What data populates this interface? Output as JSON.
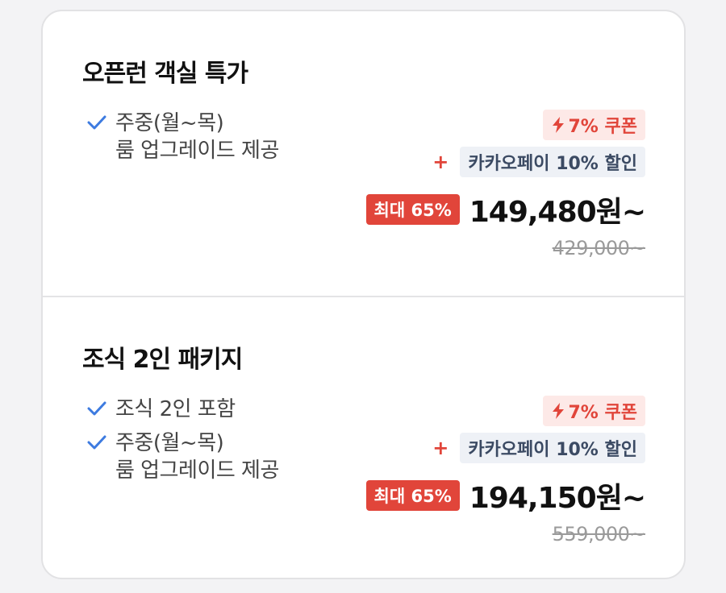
{
  "offers": [
    {
      "title": "오픈런 객실 특가",
      "benefits": [
        "주중(월~목)\n룸 업그레이드 제공"
      ],
      "coupon": "7% 쿠폰",
      "plus": "+",
      "pay_discount": "카카오페이 10% 할인",
      "max_discount": "최대 65%",
      "price": "149,480원~",
      "original_price": "429,000~"
    },
    {
      "title": "조식 2인 패키지",
      "benefits": [
        "조식 2인 포함",
        "주중(월~목)\n룸 업그레이드 제공"
      ],
      "coupon": "7% 쿠폰",
      "plus": "+",
      "pay_discount": "카카오페이 10% 할인",
      "max_discount": "최대 65%",
      "price": "194,150원~",
      "original_price": "559,000~"
    }
  ],
  "colors": {
    "accent_red": "#e1453a",
    "check_blue": "#3d7be0",
    "pay_badge_bg": "#eef1f6"
  },
  "icons": {
    "check": "check-icon",
    "coupon": "lightning-icon"
  }
}
